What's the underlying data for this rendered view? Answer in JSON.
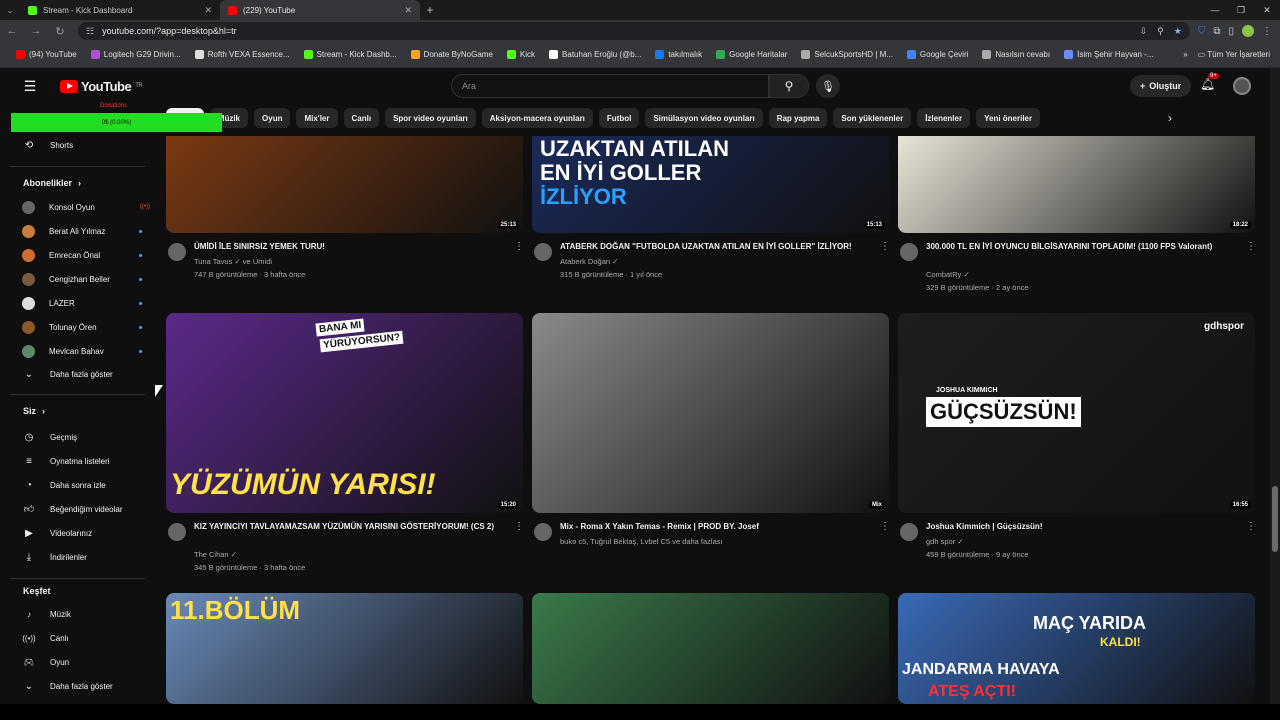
{
  "browser": {
    "tabs": [
      {
        "title": "Stream - Kick Dashboard",
        "color": "#53fc18",
        "active": false
      },
      {
        "title": "(229) YouTube",
        "color": "#ff0000",
        "active": true
      }
    ],
    "url": "youtube.com/?app=desktop&hl=tr",
    "bookmarks": [
      {
        "label": "(94) YouTube",
        "color": "#ff0000"
      },
      {
        "label": "Logitech G29 Drivin...",
        "color": "#b04fd6"
      },
      {
        "label": "Rofth VEXA Essence...",
        "color": "#dddddd"
      },
      {
        "label": "Stream - Kick Dashb...",
        "color": "#53fc18"
      },
      {
        "label": "Donate ByNoGame",
        "color": "#f5a623"
      },
      {
        "label": "Kick",
        "color": "#53fc18"
      },
      {
        "label": "Batuhan Eroğlu (@b...",
        "color": "#ffffff"
      },
      {
        "label": "takılmalık",
        "color": "#1877f2"
      },
      {
        "label": "Google Haritalar",
        "color": "#34a853"
      },
      {
        "label": "SelcukSportsHD | M...",
        "color": "#aaaaaa"
      },
      {
        "label": "Google Çeviri",
        "color": "#4285f4"
      },
      {
        "label": "Nasılsın cevabı",
        "color": "#aaaaaa"
      },
      {
        "label": "İsim Şehir Hayvan -...",
        "color": "#6b8cff"
      }
    ],
    "bookmarks_overflow": "»",
    "all_bookmarks": "Tüm Yer İşaretleri"
  },
  "header": {
    "logo_text": "YouTube",
    "logo_country": "TR",
    "search_placeholder": "Ara",
    "create_label": "Oluştur",
    "notifications_badge": "9+"
  },
  "overlay": {
    "text": "0$ (0.00%)",
    "red_label": "Donations"
  },
  "chips": [
    "Tümü",
    "Müzik",
    "Oyun",
    "Mix'ler",
    "Canlı",
    "Spor video oyunları",
    "Aksiyon-macera oyunları",
    "Futbol",
    "Simülasyon video oyunları",
    "Rap yapma",
    "Son yüklenenler",
    "İzlenenler",
    "Yeni öneriler"
  ],
  "sidebar": {
    "shorts": "Shorts",
    "subscriptions_title": "Abonelikler",
    "subscriptions": [
      {
        "name": "Konsol Oyun",
        "color": "#666",
        "live": true
      },
      {
        "name": "Berat Ali Yılmaz",
        "color": "#c97d3a",
        "live": false
      },
      {
        "name": "Emrecan Önal",
        "color": "#d06b2e",
        "live": false
      },
      {
        "name": "Cengizhan Beller",
        "color": "#7a5a3c",
        "live": false
      },
      {
        "name": "LAZER",
        "color": "#ddd",
        "live": false
      },
      {
        "name": "Tolunay Ören",
        "color": "#8b5a2b",
        "live": false
      },
      {
        "name": "Mevlcan Bahav",
        "color": "#5a8a6a",
        "live": false
      }
    ],
    "show_more": "Daha fazla göster",
    "you_title": "Siz",
    "you_items": [
      "Geçmiş",
      "Oynatma listeleri",
      "Daha sonra izle",
      "Beğendiğim videolar",
      "Videolarınız",
      "İndirilenler"
    ],
    "explore_title": "Keşfet",
    "explore_items": [
      "Müzik",
      "Canlı",
      "Oyun"
    ],
    "explore_more": "Daha fazla göster"
  },
  "videos": [
    {
      "title": "ÜMİDİ İLE SINIRSIZ YEMEK TURU!",
      "channel": "Tuna Tavus ✓ ve Ümidi",
      "meta": "747 B görüntüleme · 3 hafta önce",
      "duration": "25:13",
      "thumb_color": "#7a3a12"
    },
    {
      "title": "ATABERK DOĞAN \"FUTBOLDA UZAKTAN ATILAN EN İYİ GOLLER\" İZLİYOR!",
      "channel": "Ataberk Doğan ✓",
      "meta": "315 B görüntüleme · 1 yıl önce",
      "duration": "15:13",
      "thumb_color": "#1a2a5a",
      "thumb_text": [
        "UZAKTAN ATILAN",
        "EN İYİ GOLLER",
        "İZLİYOR"
      ]
    },
    {
      "title": "300.000 TL EN İYİ OYUNCU BİLGİSAYARINI TOPLADIM! (1100 FPS Valorant)",
      "channel": "CombatRy ✓",
      "meta": "329 B görüntüleme · 2 ay önce",
      "duration": "18:22",
      "thumb_color": "#e8e4d8"
    },
    {
      "title": "KIZ YAYINCIYI TAVLAYAMAZSAM YÜZÜMÜN YARISINI GÖSTERİYORUM! (CS 2)",
      "channel": "The Cihan ✓",
      "meta": "345 B görüntüleme · 3 hafta önce",
      "duration": "15:20",
      "thumb_color": "#5a2a8a",
      "thumb_text": [
        "BANA MI",
        "YÜRÜYORSUN?",
        "YÜZÜMÜN YARISI!"
      ]
    },
    {
      "title": "Mix - Roma X Yakın Temas - Remix | PROD BY. Josef",
      "channel": "buko c5, Tuğrul Bektaş, Lvbel C5 ve daha fazlası",
      "meta": "",
      "duration": "Mix",
      "thumb_color": "#8a8a8a"
    },
    {
      "title": "Joshua Kimmich | Güçsüzsün!",
      "channel": "gdh spor ✓",
      "meta": "459 B görüntüleme · 9 ay önce",
      "duration": "16:55",
      "thumb_color": "#1e1e1e",
      "thumb_text": [
        "JOSHUA KIMMICH",
        "GÜÇSÜZSÜN!",
        "gdhspor"
      ]
    },
    {
      "title": "",
      "channel": "",
      "meta": "",
      "duration": "",
      "thumb_color": "#6a8ab8",
      "thumb_text": [
        "11.BÖLÜM"
      ]
    },
    {
      "title": "",
      "channel": "",
      "meta": "",
      "duration": "",
      "thumb_color": "#3a7a4a"
    },
    {
      "title": "",
      "channel": "",
      "meta": "",
      "duration": "",
      "thumb_color": "#3a6ab8",
      "thumb_text": [
        "MAÇ YARIDA",
        "KALDI!",
        "JANDARMA HAVAYA",
        "ATEŞ AÇTI!"
      ]
    }
  ],
  "colors": {
    "accent": "#ff0000",
    "background": "#0f0f0f",
    "overlay": "#22dd22"
  }
}
